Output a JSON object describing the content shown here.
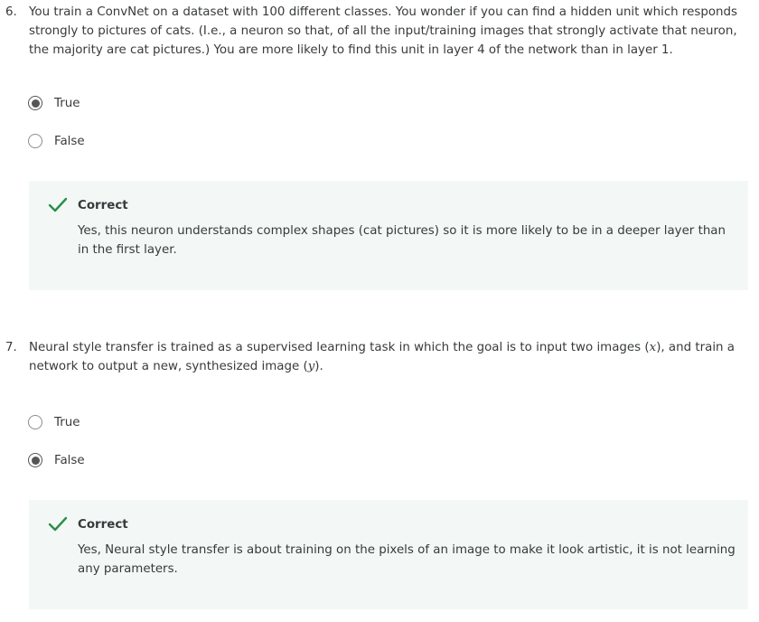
{
  "questions": [
    {
      "number": "6.",
      "text": "You train a ConvNet on a dataset with 100 different classes. You wonder if you can find a hidden unit which responds strongly to pictures of cats. (I.e., a neuron so that, of all the input/training images that strongly activate that neuron, the majority are cat pictures.) You are more likely to find this unit in layer 4 of the network than in layer 1.",
      "options": [
        {
          "label": "True",
          "selected": true
        },
        {
          "label": "False",
          "selected": false
        }
      ],
      "feedback": {
        "title": "Correct",
        "text": "Yes, this neuron understands complex shapes (cat pictures) so it is more likely to be in a deeper layer than in the first layer."
      }
    },
    {
      "number": "7.",
      "text_before": "Neural style transfer is trained as a supervised learning task in which the goal is to input two images (",
      "var_x": "x",
      "text_middle": "), and train a network to output a new, synthesized image (",
      "var_y": "y",
      "text_after": ").",
      "options": [
        {
          "label": "True",
          "selected": false
        },
        {
          "label": "False",
          "selected": true
        }
      ],
      "feedback": {
        "title": "Correct",
        "text": "Yes, Neural style transfer is about training on the pixels of an image to make it look artistic, it is not learning any parameters."
      }
    }
  ],
  "colors": {
    "correct_green": "#2a8e46",
    "feedback_bg": "#f3f8f6",
    "text": "#373a3c"
  },
  "icons": {
    "feedback": "checkmark-icon"
  }
}
